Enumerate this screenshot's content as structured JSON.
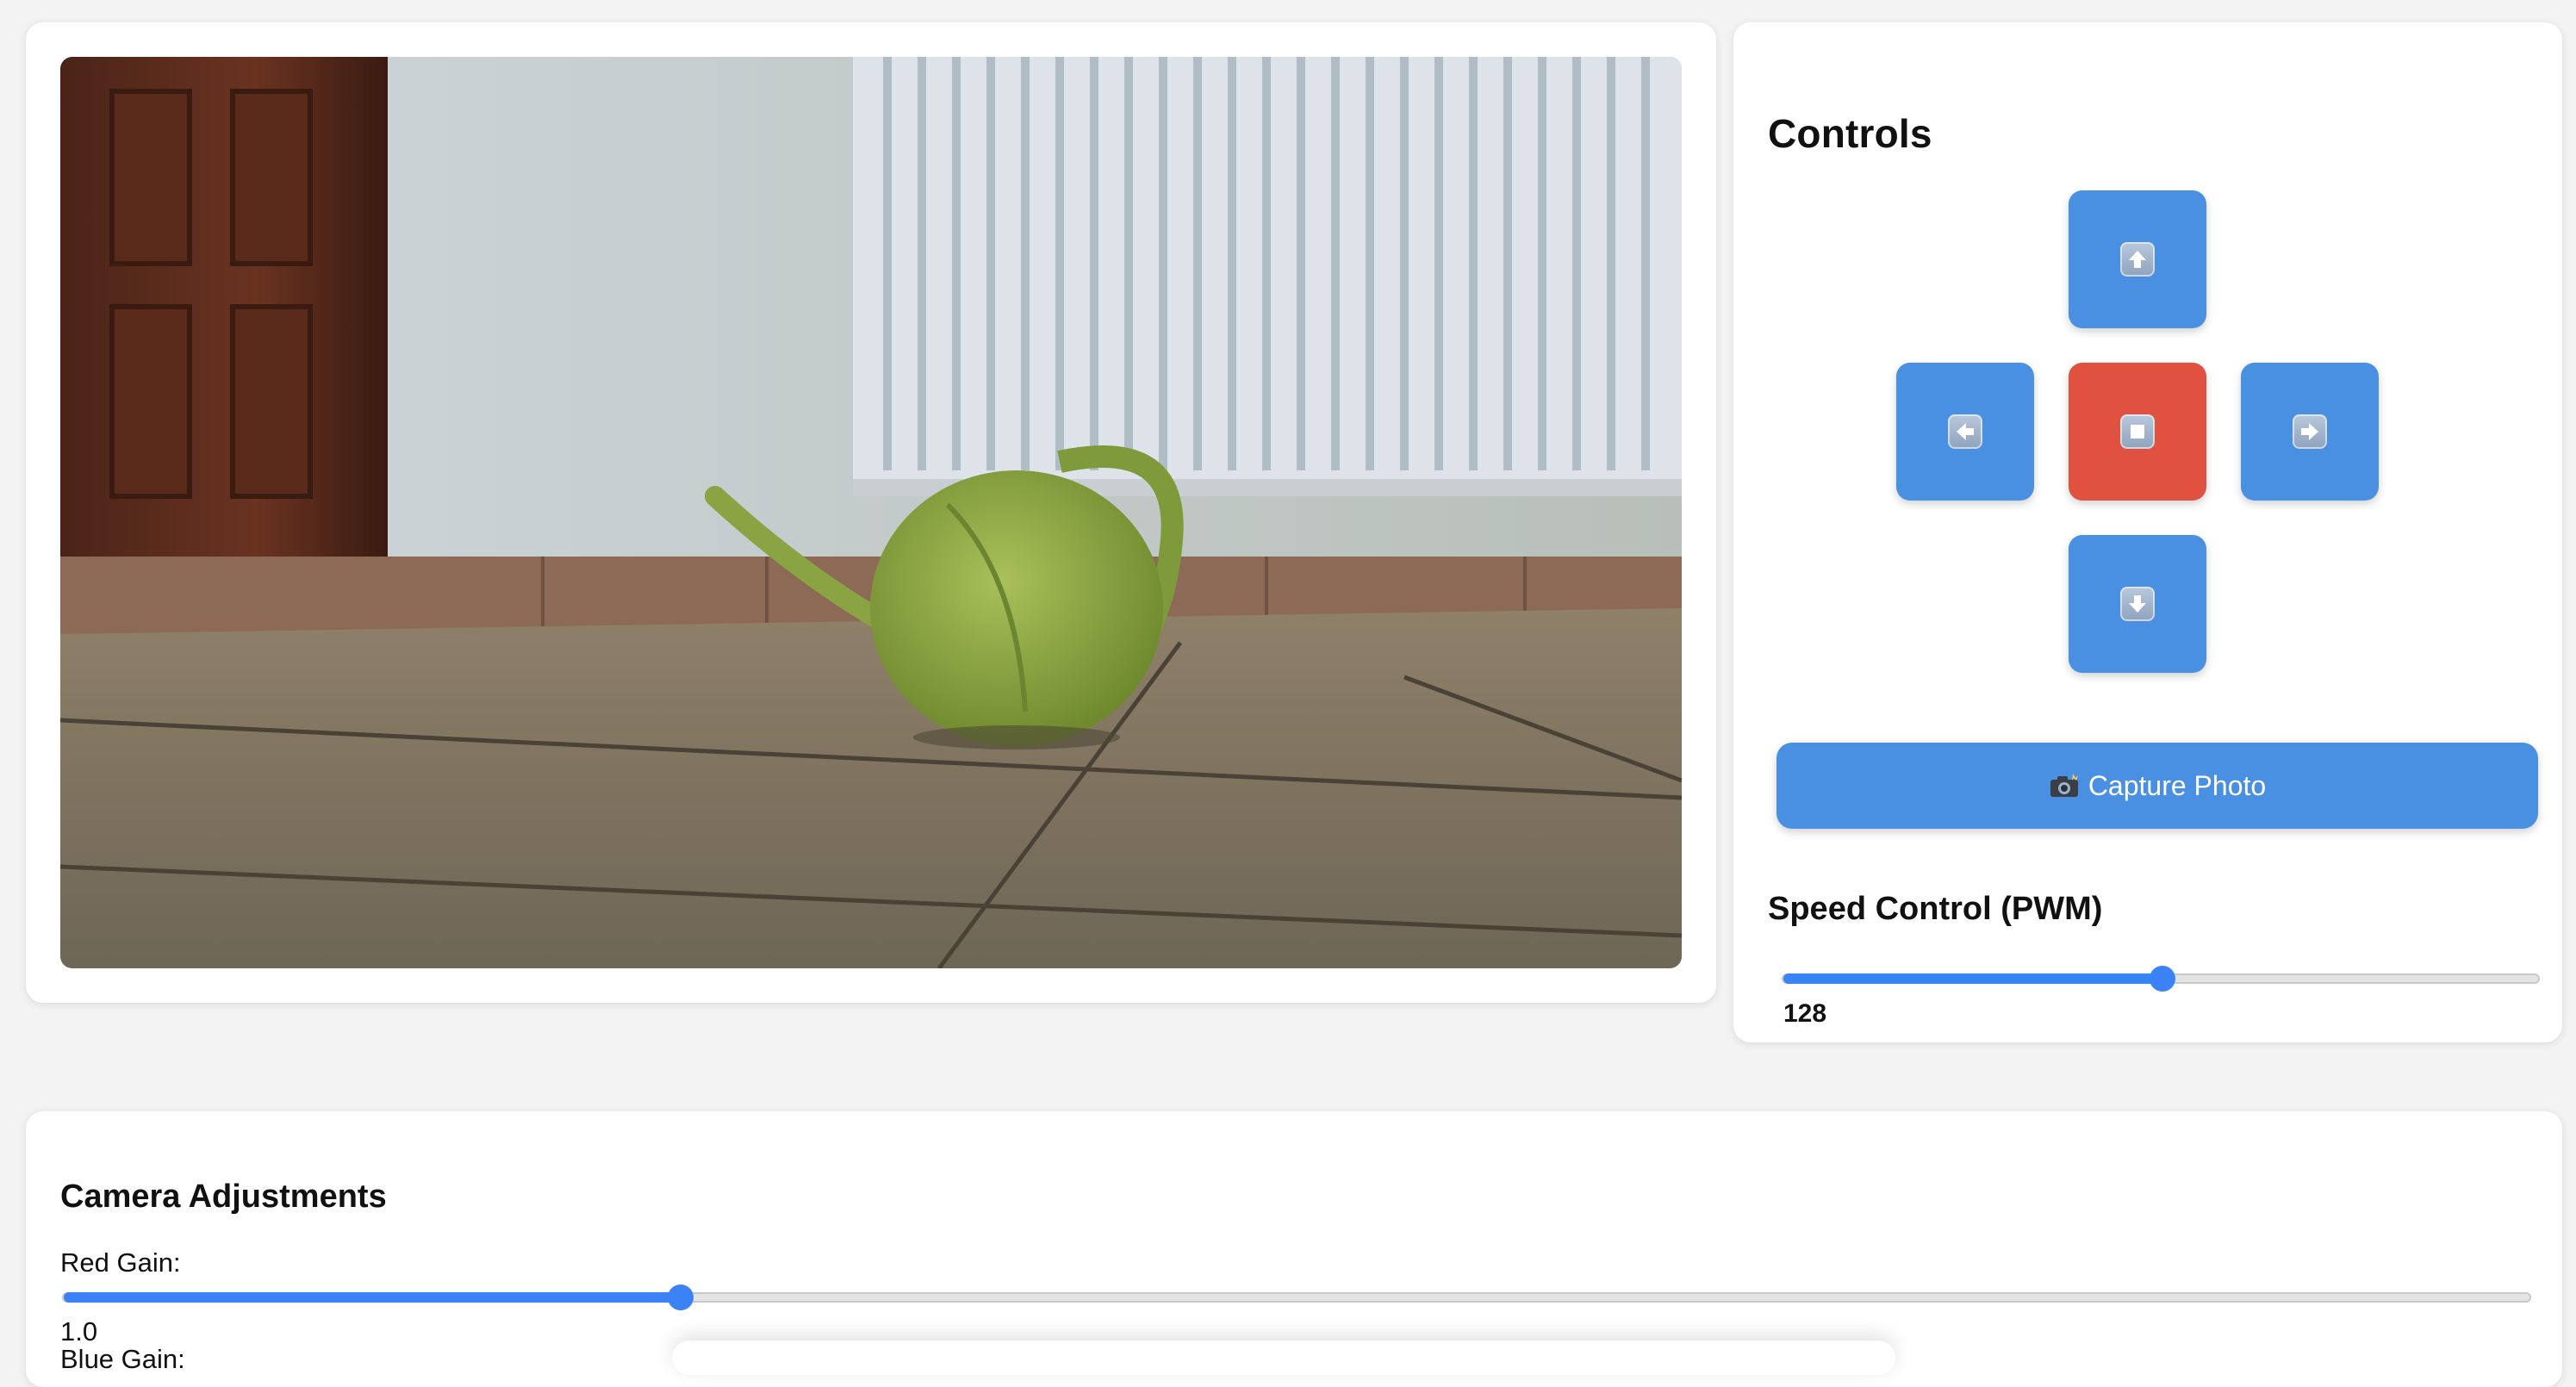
{
  "video": {
    "alt": "Live camera feed"
  },
  "controls": {
    "title": "Controls",
    "buttons": {
      "up_icon": "up-arrow-icon",
      "left_icon": "left-arrow-icon",
      "stop_icon": "stop-square-icon",
      "right_icon": "right-arrow-icon",
      "down_icon": "down-arrow-icon"
    },
    "capture_label": "Capture Photo",
    "capture_icon": "camera-flash-icon",
    "speed": {
      "title": "Speed Control (PWM)",
      "value": "128",
      "min": 0,
      "max": 255,
      "fraction": 0.502
    }
  },
  "camera": {
    "title": "Camera Adjustments",
    "red_gain": {
      "label": "Red Gain:",
      "value": "1.0",
      "fraction": 0.25
    },
    "blue_gain": {
      "label": "Blue Gain:"
    }
  },
  "colors": {
    "primary": "#4a90e2",
    "stop": "#e05140",
    "slider": "#3b82f6",
    "background": "#f3f3f3"
  }
}
